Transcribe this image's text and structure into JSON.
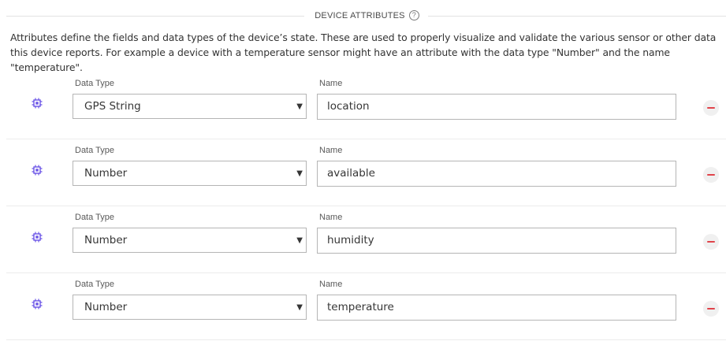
{
  "section": {
    "title": "DEVICE ATTRIBUTES",
    "help_glyph": "?"
  },
  "description": "Attributes define the fields and data types of the device’s state. These are used to properly visualize and validate the various sensor or other data this device reports. For example a device with a temperature sensor might have an attribute with the data type \"Number\" and the name \"temperature\".",
  "labels": {
    "data_type": "Data Type",
    "name": "Name"
  },
  "colors": {
    "chip_icon": "#6b55e6",
    "remove_icon": "#e0434a",
    "remove_bg": "#f0f0f0"
  },
  "attributes": [
    {
      "data_type": "GPS String",
      "name": "location"
    },
    {
      "data_type": "Number",
      "name": "available"
    },
    {
      "data_type": "Number",
      "name": "humidity"
    },
    {
      "data_type": "Number",
      "name": "temperature"
    }
  ],
  "caret_glyph": "▼"
}
